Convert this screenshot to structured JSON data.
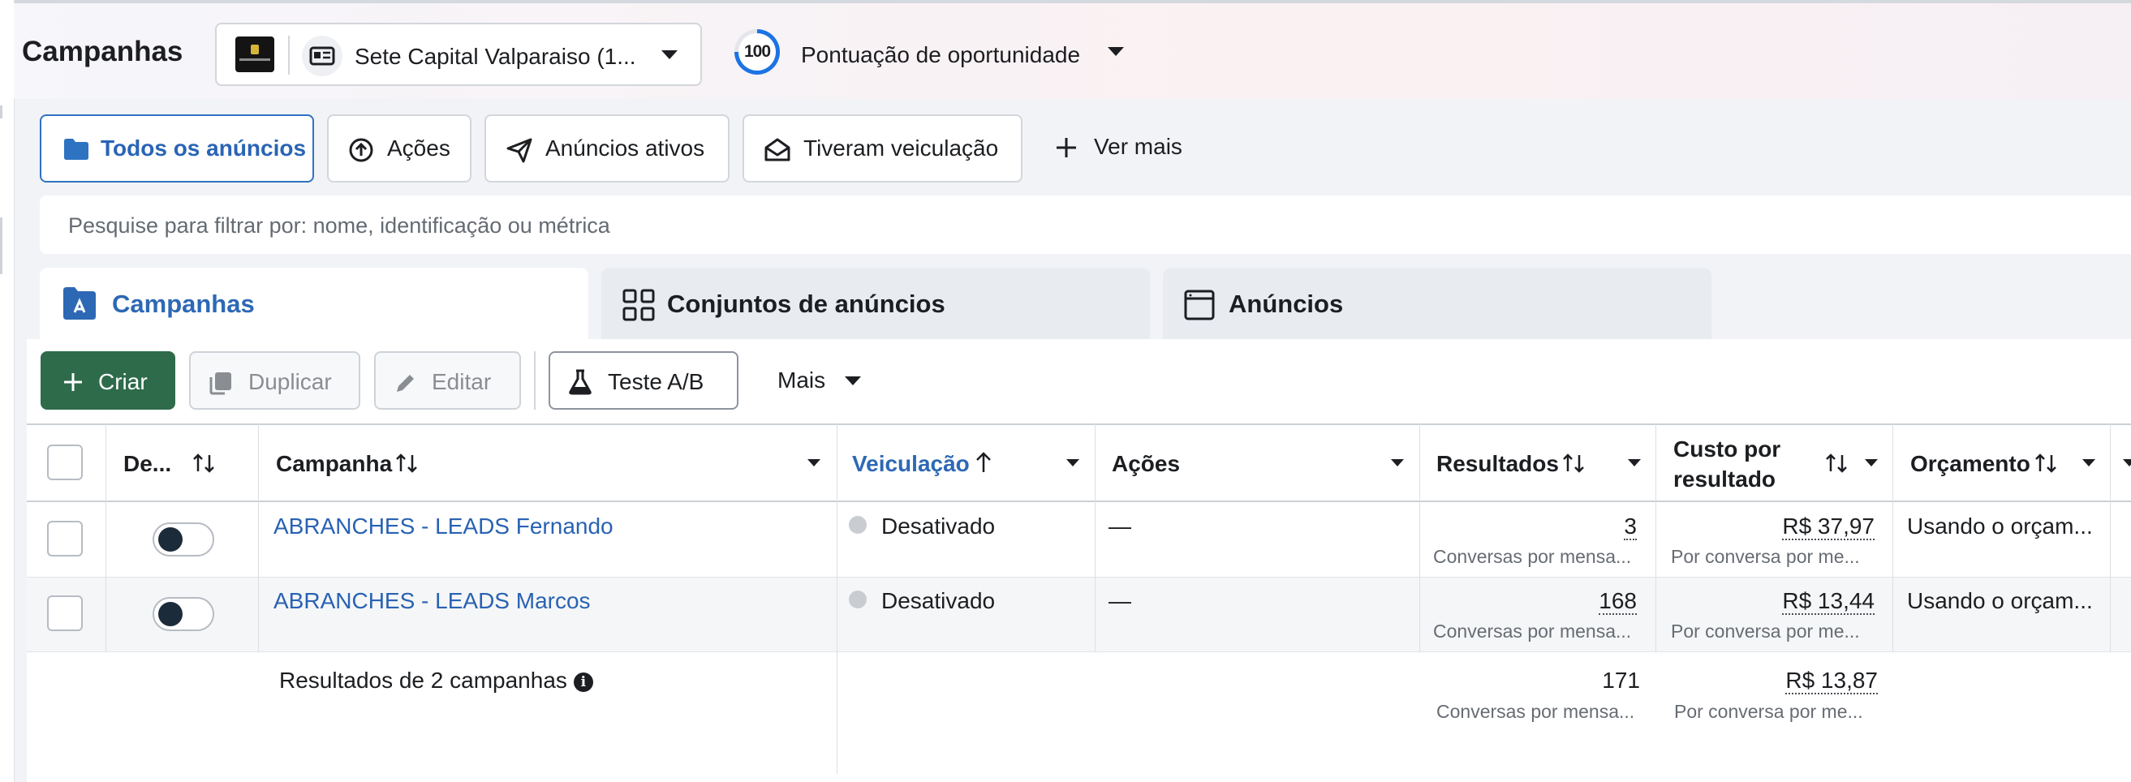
{
  "header": {
    "title": "Campanhas",
    "account_name": "Sete Capital Valparaiso (1...",
    "opportunity_score": "100",
    "opportunity_label": "Pontuação de oportunidade"
  },
  "filters": [
    {
      "label": "Todos os anúncios",
      "icon": "folder-icon",
      "active": true
    },
    {
      "label": "Ações",
      "icon": "upload-circle-icon",
      "active": false
    },
    {
      "label": "Anúncios ativos",
      "icon": "paper-plane-icon",
      "active": false
    },
    {
      "label": "Tiveram veiculação",
      "icon": "open-envelope-icon",
      "active": false
    }
  ],
  "see_more": "Ver mais",
  "search": {
    "placeholder": "Pesquise para filtrar por: nome, identificação ou métrica"
  },
  "level_tabs": [
    {
      "label": "Campanhas",
      "icon": "campaign-folder-icon",
      "active": true
    },
    {
      "label": "Conjuntos de anúncios",
      "icon": "grid-icon",
      "active": false
    },
    {
      "label": "Anúncios",
      "icon": "ad-window-icon",
      "active": false
    }
  ],
  "toolbar": {
    "create": "Criar",
    "duplicate": "Duplicar",
    "edit": "Editar",
    "ab_test": "Teste A/B",
    "more": "Mais"
  },
  "table": {
    "columns": {
      "delivery_toggle": "De...",
      "campaign": "Campanha",
      "delivery": "Veiculação",
      "actions": "Ações",
      "results": "Resultados",
      "cost_per_result_line1": "Custo por",
      "cost_per_result_line2": "resultado",
      "budget": "Orçamento"
    },
    "rows": [
      {
        "name": "ABRANCHES - LEADS Fernando",
        "status": "Desativado",
        "actions": "—",
        "results": "3",
        "results_sub": "Conversas por mensa...",
        "cost": "R$ 37,97",
        "cost_sub": "Por conversa por me...",
        "budget": "Usando o orçam..."
      },
      {
        "name": "ABRANCHES - LEADS Marcos",
        "status": "Desativado",
        "actions": "—",
        "results": "168",
        "results_sub": "Conversas por mensa...",
        "cost": "R$ 13,44",
        "cost_sub": "Por conversa por me...",
        "budget": "Usando o orçam..."
      }
    ],
    "summary": {
      "label": "Resultados de 2 campanhas",
      "info_icon": "i",
      "results": "171",
      "results_sub": "Conversas por mensa...",
      "cost": "R$ 13,87",
      "cost_sub": "Por conversa por me..."
    }
  },
  "colors": {
    "accent_blue": "#2d68b4",
    "create_green": "#2e6b4b",
    "link_blue": "#2962b3"
  }
}
